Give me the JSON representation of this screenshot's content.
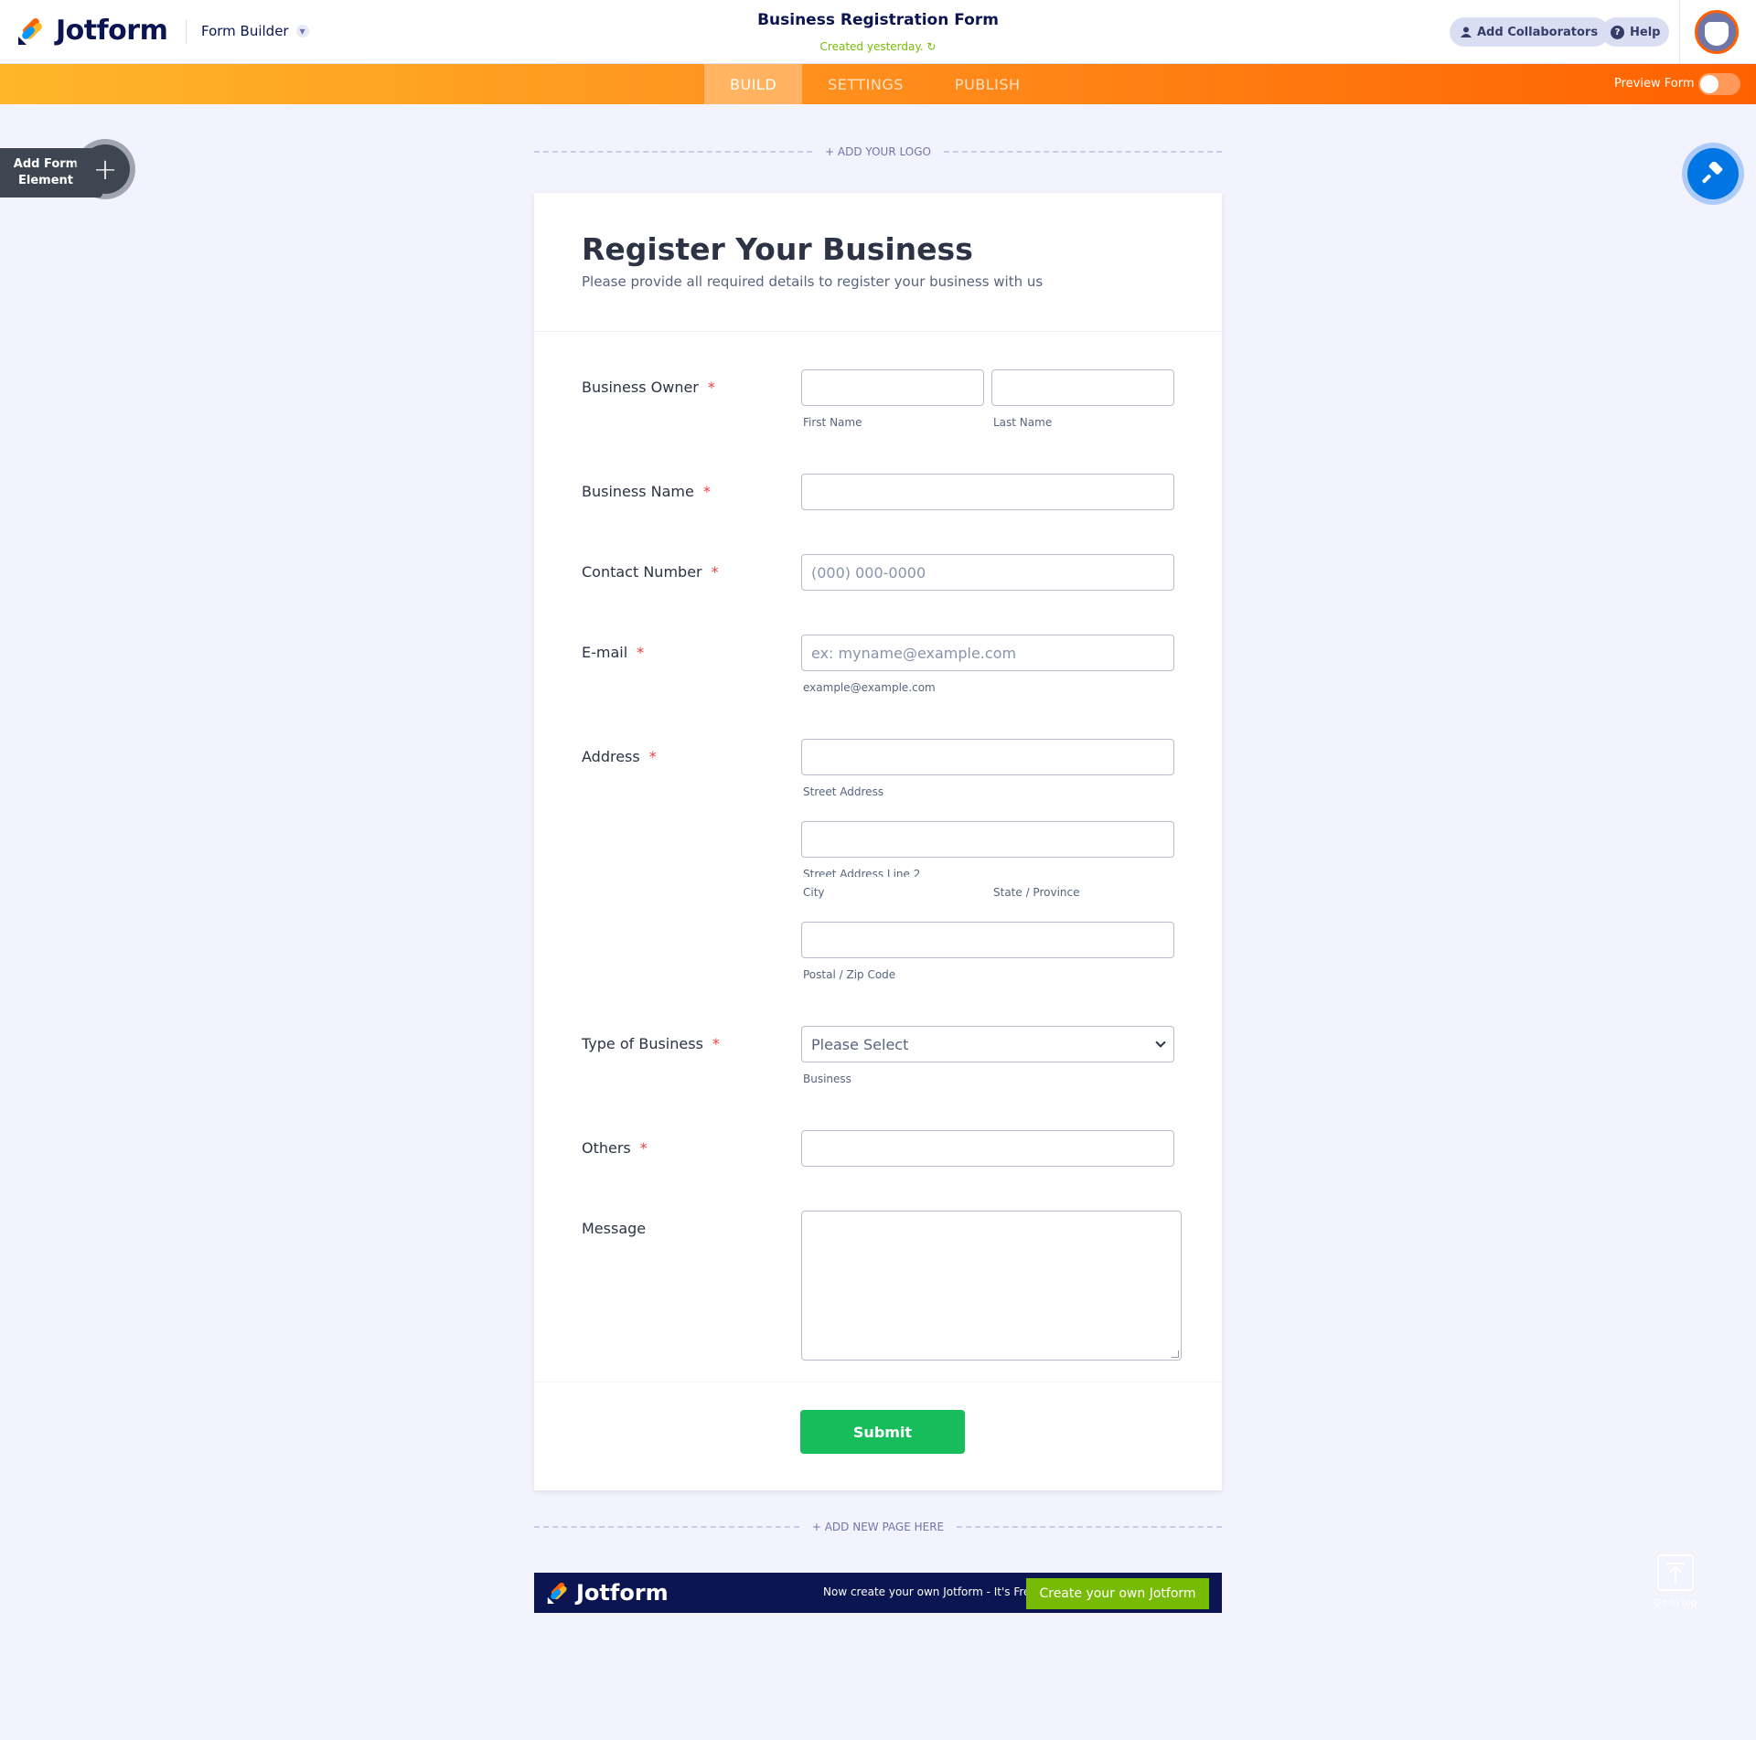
{
  "header": {
    "brand": "Jotform",
    "product_switch": "Form Builder",
    "form_title": "Business Registration Form",
    "created_status": "Created yesterday.",
    "add_collaborators": "Add Collaborators",
    "help": "Help"
  },
  "nav": {
    "tabs": [
      {
        "label": "BUILD",
        "active": true
      },
      {
        "label": "SETTINGS",
        "active": false
      },
      {
        "label": "PUBLISH",
        "active": false
      }
    ],
    "preview_label": "Preview Form",
    "preview_on": false
  },
  "builder": {
    "add_element_label_line1": "Add Form",
    "add_element_label_line2": "Element",
    "add_logo": "+ ADD YOUR LOGO",
    "add_page": "+ ADD NEW PAGE HERE",
    "go_to_top": "Go to top"
  },
  "form": {
    "heading": "Register Your Business",
    "subheading": "Please provide all required details to register your business with us",
    "fields": {
      "owner": {
        "label": "Business Owner",
        "required": "*",
        "first_sub": "First Name",
        "last_sub": "Last Name"
      },
      "business_name": {
        "label": "Business Name",
        "required": "*"
      },
      "contact": {
        "label": "Contact Number",
        "required": "*",
        "placeholder": "(000) 000-0000"
      },
      "email": {
        "label": "E-mail",
        "required": "*",
        "placeholder": "ex: myname@example.com",
        "sub": "example@example.com"
      },
      "address": {
        "label": "Address",
        "required": "*",
        "street_sub": "Street Address",
        "street2_sub": "Street Address Line 2",
        "city_sub": "City",
        "state_sub": "State / Province",
        "zip_sub": "Postal / Zip Code"
      },
      "type": {
        "label": "Type of Business",
        "required": "*",
        "value": "Please Select",
        "sub": "Business"
      },
      "others": {
        "label": "Others",
        "required": "*"
      },
      "message": {
        "label": "Message"
      }
    },
    "submit": "Submit"
  },
  "footer_banner": {
    "brand": "Jotform",
    "text": "Now create your own Jotform - It's Free",
    "cta": "Create your own Jotform"
  },
  "colors": {
    "brand_navy": "#0a1551",
    "accent_orange": "#ff6100",
    "submit_green": "#18bd5b",
    "required_red": "#f23a3c",
    "design_blue": "#0075e3"
  }
}
